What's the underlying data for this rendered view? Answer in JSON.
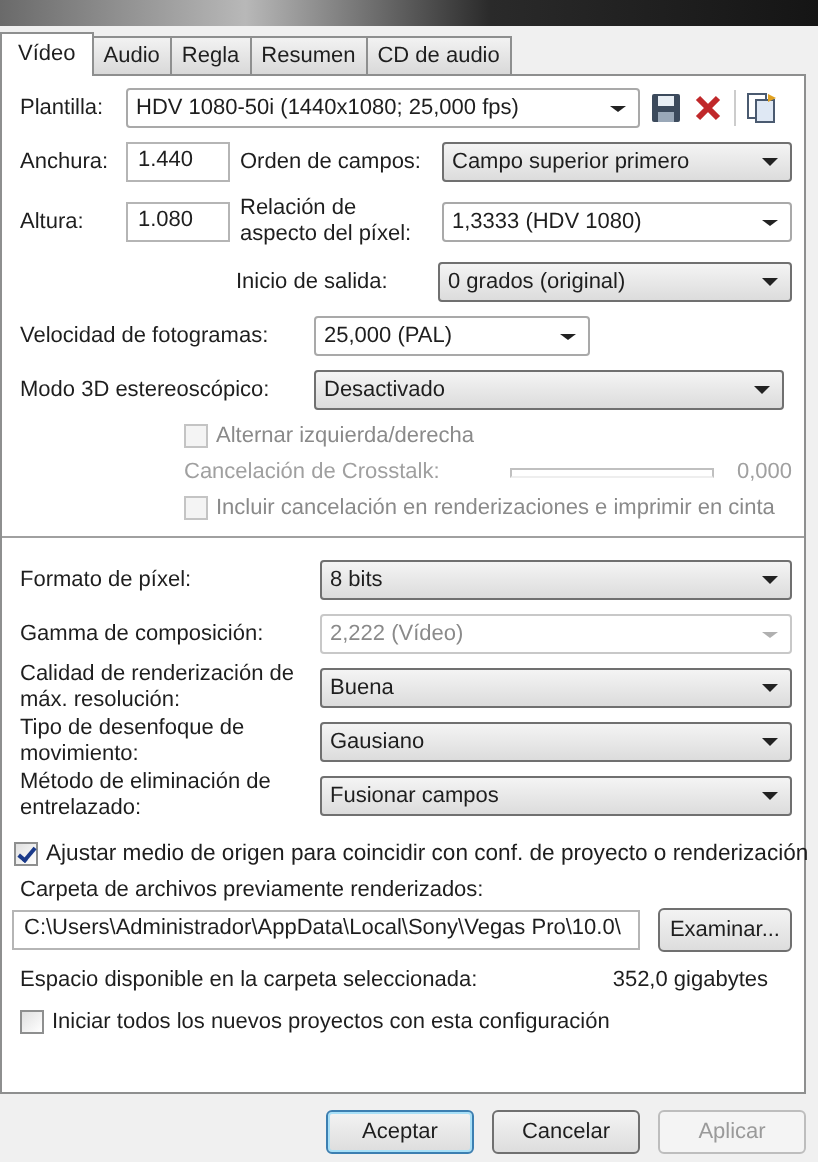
{
  "tabs": [
    {
      "label": "Vídeo",
      "selected": true
    },
    {
      "label": "Audio",
      "selected": false
    },
    {
      "label": "Regla",
      "selected": false
    },
    {
      "label": "Resumen",
      "selected": false
    },
    {
      "label": "CD de audio",
      "selected": false
    }
  ],
  "template": {
    "label": "Plantilla:",
    "value": "HDV 1080-50i (1440x1080; 25,000 fps)"
  },
  "width": {
    "label": "Anchura:",
    "value": "1.440"
  },
  "height": {
    "label": "Altura:",
    "value": "1.080"
  },
  "field_order": {
    "label": "Orden de campos:",
    "value": "Campo superior primero",
    "kind": "list"
  },
  "pixel_aspect": {
    "label": "Relación de aspecto del píxel:",
    "value": "1,3333 (HDV 1080)",
    "kind": "combo"
  },
  "output_rotation": {
    "label": "Inicio de salida:",
    "value": "0 grados (original)",
    "kind": "list"
  },
  "frame_rate": {
    "label": "Velocidad de fotogramas:",
    "value": "25,000 (PAL)",
    "kind": "combo"
  },
  "stereo_3d": {
    "label": "Modo 3D estereoscópico:",
    "value": "Desactivado",
    "kind": "list"
  },
  "swap_checkbox": {
    "label": "Alternar izquierda/derecha",
    "checked": false,
    "disabled": true
  },
  "crosstalk": {
    "label": "Cancelación de Crosstalk:",
    "reading": "0,000",
    "disabled": true
  },
  "include_checkbox": {
    "label": "Incluir cancelación en renderizaciones e imprimir en cinta",
    "checked": false,
    "disabled": true
  },
  "render_settings": [
    {
      "label": "Formato de píxel:",
      "value": "8 bits",
      "kind": "list",
      "disabled": false
    },
    {
      "label": "Gamma de composición:",
      "value": "2,222 (Vídeo)",
      "kind": "combo",
      "disabled": true
    },
    {
      "label": "Calidad de renderización de máx. resolución:",
      "value": "Buena",
      "kind": "list",
      "disabled": false
    },
    {
      "label": "Tipo de desenfoque de movimiento:",
      "value": "Gausiano",
      "kind": "list",
      "disabled": false
    },
    {
      "label": "Método de eliminación de entrelazado:",
      "value": "Fusionar campos",
      "kind": "list",
      "disabled": false
    }
  ],
  "adjust_checkbox": {
    "label": "Ajustar medio de origen para coincidir con conf. de proyecto o renderización",
    "checked": true,
    "disabled": false
  },
  "folder": {
    "label": "Carpeta de archivos previamente renderizados:",
    "path": "C:\\Users\\Administrador\\AppData\\Local\\Sony\\Vegas Pro\\10.0\\",
    "browse_button": "Examinar..."
  },
  "free_space": {
    "label": "Espacio disponible en la carpeta seleccionada:",
    "value": "352,0 gigabytes"
  },
  "start_checkbox": {
    "label": "Iniciar todos los nuevos proyectos con esta configuración",
    "checked": false,
    "disabled": false
  },
  "buttons": [
    {
      "label": "Aceptar",
      "disabled": false,
      "default": true
    },
    {
      "label": "Cancelar",
      "disabled": false,
      "default": false
    },
    {
      "label": "Aplicar",
      "disabled": true,
      "default": false
    }
  ]
}
